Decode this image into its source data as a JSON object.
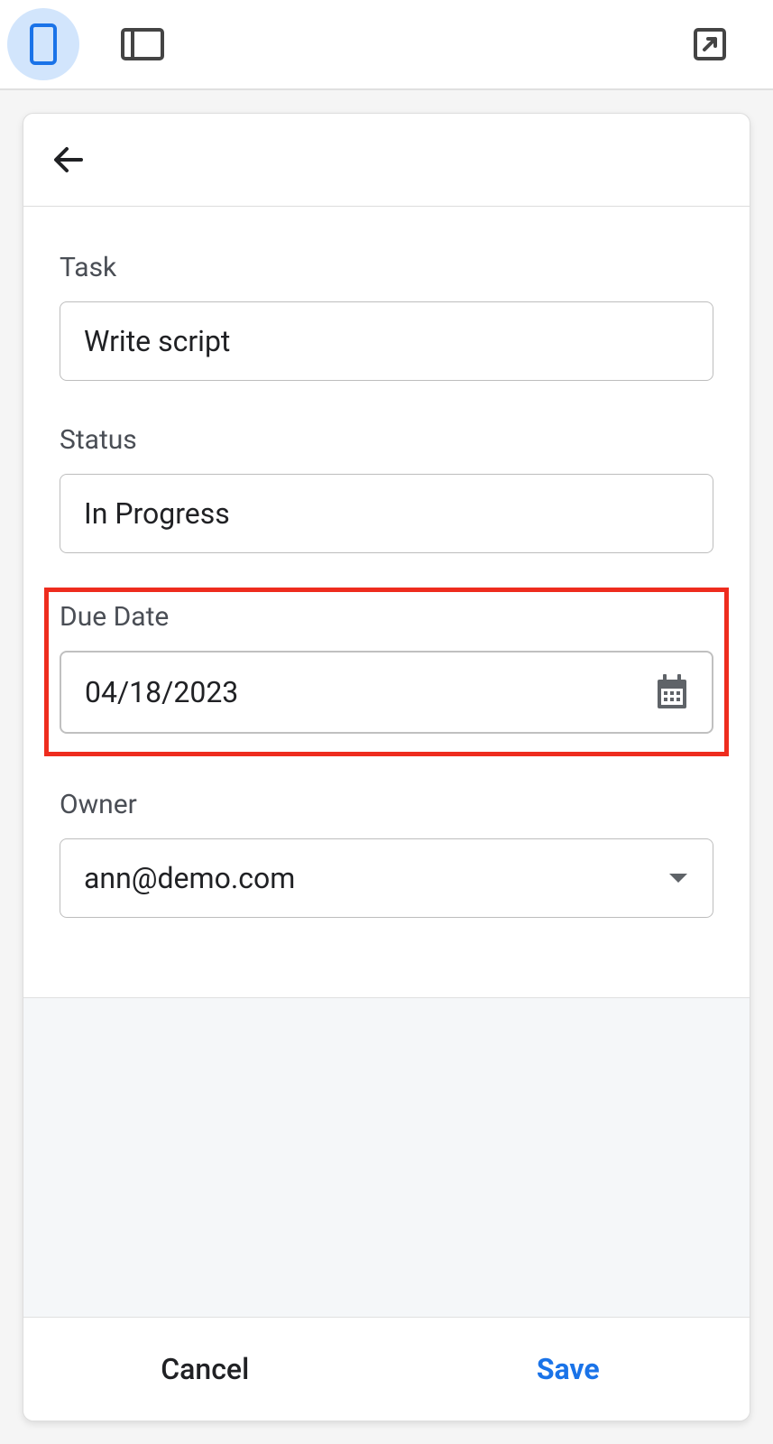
{
  "toolbar": {
    "mobile_view": "mobile-icon",
    "tablet_view": "tablet-icon",
    "external_link": "external-link-icon"
  },
  "form": {
    "fields": {
      "task": {
        "label": "Task",
        "value": "Write script"
      },
      "status": {
        "label": "Status",
        "value": "In Progress"
      },
      "due_date": {
        "label": "Due Date",
        "value": "04/18/2023"
      },
      "owner": {
        "label": "Owner",
        "value": "ann@demo.com"
      }
    }
  },
  "footer": {
    "cancel": "Cancel",
    "save": "Save"
  }
}
